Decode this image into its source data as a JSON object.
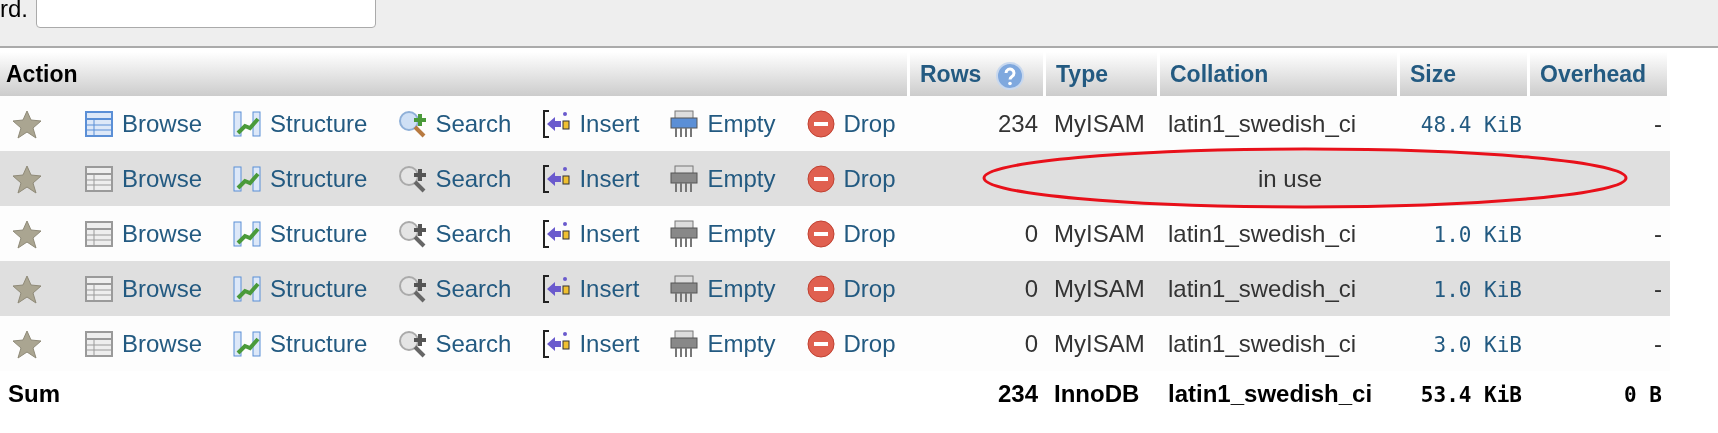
{
  "search_form": {
    "label": "rd."
  },
  "columns": [
    {
      "label": "Action"
    },
    {
      "label": "Rows",
      "help": true
    },
    {
      "label": "Type"
    },
    {
      "label": "Collation"
    },
    {
      "label": "Size"
    },
    {
      "label": "Overhead"
    }
  ],
  "rows": [
    {
      "kind": "table",
      "has_data": true,
      "actions": [
        {
          "kind": "browse",
          "label": "Browse"
        },
        {
          "kind": "structure",
          "label": "Structure"
        },
        {
          "kind": "search",
          "label": "Search"
        },
        {
          "kind": "insert",
          "label": "Insert"
        },
        {
          "kind": "empty",
          "label": "Empty"
        },
        {
          "kind": "drop",
          "label": "Drop"
        }
      ],
      "cells": [
        "234",
        "MyISAM",
        "latin1_swedish_ci",
        "48.4 KiB",
        "-"
      ]
    },
    {
      "kind": "in_use",
      "has_data": false,
      "circled": true,
      "actions": [
        {
          "kind": "browse",
          "label": "Browse"
        },
        {
          "kind": "structure",
          "label": "Structure"
        },
        {
          "kind": "search",
          "label": "Search"
        },
        {
          "kind": "insert",
          "label": "Insert"
        },
        {
          "kind": "empty",
          "label": "Empty"
        },
        {
          "kind": "drop",
          "label": "Drop"
        }
      ],
      "status": "in use"
    },
    {
      "kind": "table",
      "has_data": false,
      "actions": [
        {
          "kind": "browse",
          "label": "Browse"
        },
        {
          "kind": "structure",
          "label": "Structure"
        },
        {
          "kind": "search",
          "label": "Search"
        },
        {
          "kind": "insert",
          "label": "Insert"
        },
        {
          "kind": "empty",
          "label": "Empty"
        },
        {
          "kind": "drop",
          "label": "Drop"
        }
      ],
      "cells": [
        "0",
        "MyISAM",
        "latin1_swedish_ci",
        "1.0 KiB",
        "-"
      ]
    },
    {
      "kind": "table",
      "has_data": false,
      "actions": [
        {
          "kind": "browse",
          "label": "Browse"
        },
        {
          "kind": "structure",
          "label": "Structure"
        },
        {
          "kind": "search",
          "label": "Search"
        },
        {
          "kind": "insert",
          "label": "Insert"
        },
        {
          "kind": "empty",
          "label": "Empty"
        },
        {
          "kind": "drop",
          "label": "Drop"
        }
      ],
      "cells": [
        "0",
        "MyISAM",
        "latin1_swedish_ci",
        "1.0 KiB",
        "-"
      ]
    },
    {
      "kind": "table",
      "has_data": false,
      "actions": [
        {
          "kind": "browse",
          "label": "Browse"
        },
        {
          "kind": "structure",
          "label": "Structure"
        },
        {
          "kind": "search",
          "label": "Search"
        },
        {
          "kind": "insert",
          "label": "Insert"
        },
        {
          "kind": "empty",
          "label": "Empty"
        },
        {
          "kind": "drop",
          "label": "Drop"
        }
      ],
      "cells": [
        "0",
        "MyISAM",
        "latin1_swedish_ci",
        "3.0 KiB",
        "-"
      ]
    }
  ],
  "sum": {
    "label": "Sum",
    "cells": [
      "234",
      "InnoDB",
      "latin1_swedish_ci",
      "53.4 KiB",
      "0 B"
    ]
  }
}
